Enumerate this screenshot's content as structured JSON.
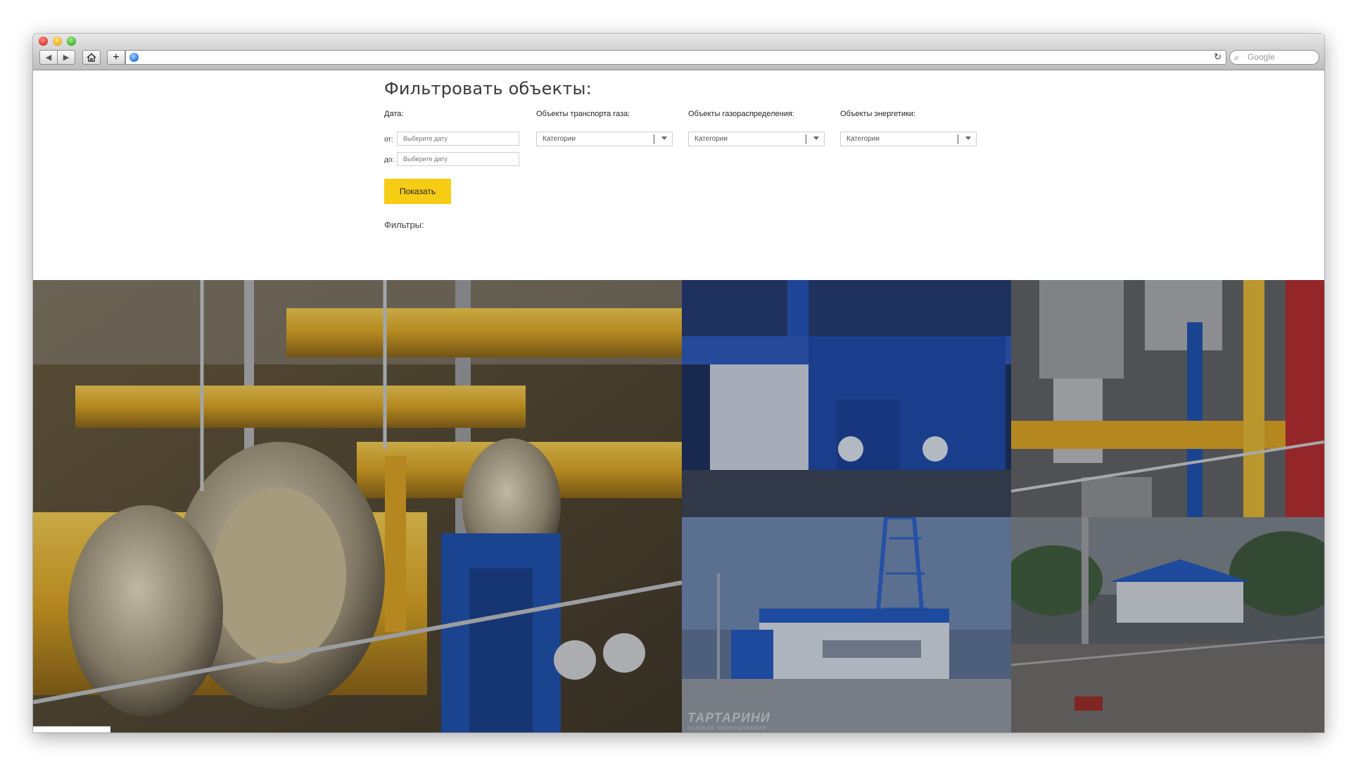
{
  "browser": {
    "search_placeholder": "Google",
    "url": ""
  },
  "filter": {
    "title": "Фильтровать объекты:",
    "date_label": "Дата:",
    "from_label": "от:",
    "to_label": "до:",
    "date_placeholder": "Выберите дату",
    "columns": [
      {
        "label": "Объекты транспорта газа:",
        "select_value": "Категории"
      },
      {
        "label": "Объекты газораспределения:",
        "select_value": "Категории"
      },
      {
        "label": "Объекты энергетики:",
        "select_value": "Категории"
      }
    ],
    "show_button": "Показать",
    "filters_label": "Фильтры:"
  },
  "gallery": {
    "watermark": "ТАРТАРИНИ",
    "watermark_sub": "ГАЗОВОЕ ОБОРУДОВАНИЕ"
  },
  "colors": {
    "accent_yellow": "#f7cc15",
    "pipe_yellow": "#e8b224",
    "structure_blue": "#1f4fa8"
  }
}
